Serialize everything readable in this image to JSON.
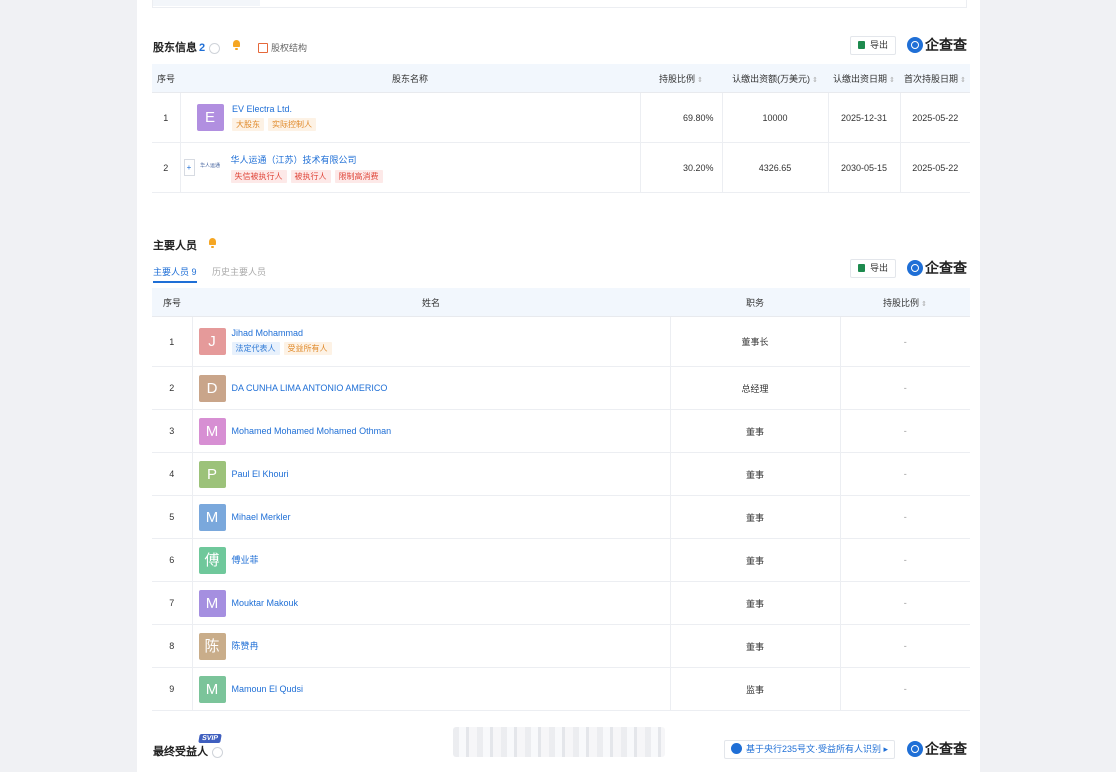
{
  "shareholders": {
    "title": "股东信息",
    "count": "2",
    "structure_link": "股权结构",
    "export_label": "导出",
    "brand": "企查查",
    "columns": [
      "序号",
      "股东名称",
      "持股比例",
      "认缴出资额(万美元)",
      "认缴出资日期",
      "首次持股日期"
    ],
    "rows": [
      {
        "no": "1",
        "avatar_letter": "E",
        "avatar_color": "#b18fe0",
        "name": "EV Electra Ltd.",
        "tags": [
          "大股东",
          "实际控制人"
        ],
        "ratio": "69.80%",
        "amount": "10000",
        "sub_date": "2025-12-31",
        "first_date": "2025-05-22"
      },
      {
        "no": "2",
        "expand": "+",
        "logo_text": "华人运通",
        "name": "华人运通（江苏）技术有限公司",
        "tags": [
          "失信被执行人",
          "被执行人",
          "限制高消费"
        ],
        "ratio": "30.20%",
        "amount": "4326.65",
        "sub_date": "2030-05-15",
        "first_date": "2025-05-22"
      }
    ]
  },
  "personnel": {
    "title": "主要人员",
    "tab_active": "主要人员",
    "tab_active_count": "9",
    "tab_history": "历史主要人员",
    "export_label": "导出",
    "brand": "企查查",
    "columns": [
      "序号",
      "姓名",
      "职务",
      "持股比例"
    ],
    "rows": [
      {
        "no": "1",
        "avatar": "J",
        "color": "#e59a9a",
        "name": "Jihad Mohammad",
        "tags": [
          "法定代表人",
          "受益所有人"
        ],
        "role": "董事长",
        "ratio": "-"
      },
      {
        "no": "2",
        "avatar": "D",
        "color": "#c9a58a",
        "name": "DA CUNHA LIMA ANTONIO AMERICO",
        "tags": [],
        "role": "总经理",
        "ratio": "-"
      },
      {
        "no": "3",
        "avatar": "M",
        "color": "#d78fd3",
        "name": "Mohamed Mohamed Mohamed Othman",
        "tags": [],
        "role": "董事",
        "ratio": "-"
      },
      {
        "no": "4",
        "avatar": "P",
        "color": "#9cc27a",
        "name": "Paul El Khouri",
        "tags": [],
        "role": "董事",
        "ratio": "-"
      },
      {
        "no": "5",
        "avatar": "M",
        "color": "#7aa8dc",
        "name": "Mihael Merkler",
        "tags": [],
        "role": "董事",
        "ratio": "-"
      },
      {
        "no": "6",
        "avatar": "傅",
        "color": "#6fc89b",
        "name": "傅业菲",
        "tags": [],
        "role": "董事",
        "ratio": "-"
      },
      {
        "no": "7",
        "avatar": "M",
        "color": "#a58fe0",
        "name": "Mouktar Makouk",
        "tags": [],
        "role": "董事",
        "ratio": "-"
      },
      {
        "no": "8",
        "avatar": "陈",
        "color": "#c9ad8a",
        "name": "陈赞冉",
        "tags": [],
        "role": "董事",
        "ratio": "-"
      },
      {
        "no": "9",
        "avatar": "M",
        "color": "#7bc49a",
        "name": "Mamoun El Qudsi",
        "tags": [],
        "role": "监事",
        "ratio": "-"
      }
    ]
  },
  "beneficiary": {
    "title": "最终受益人",
    "badge": "SVIP",
    "note": "基于央行235号文·受益所有人识别",
    "brand": "企查查"
  }
}
